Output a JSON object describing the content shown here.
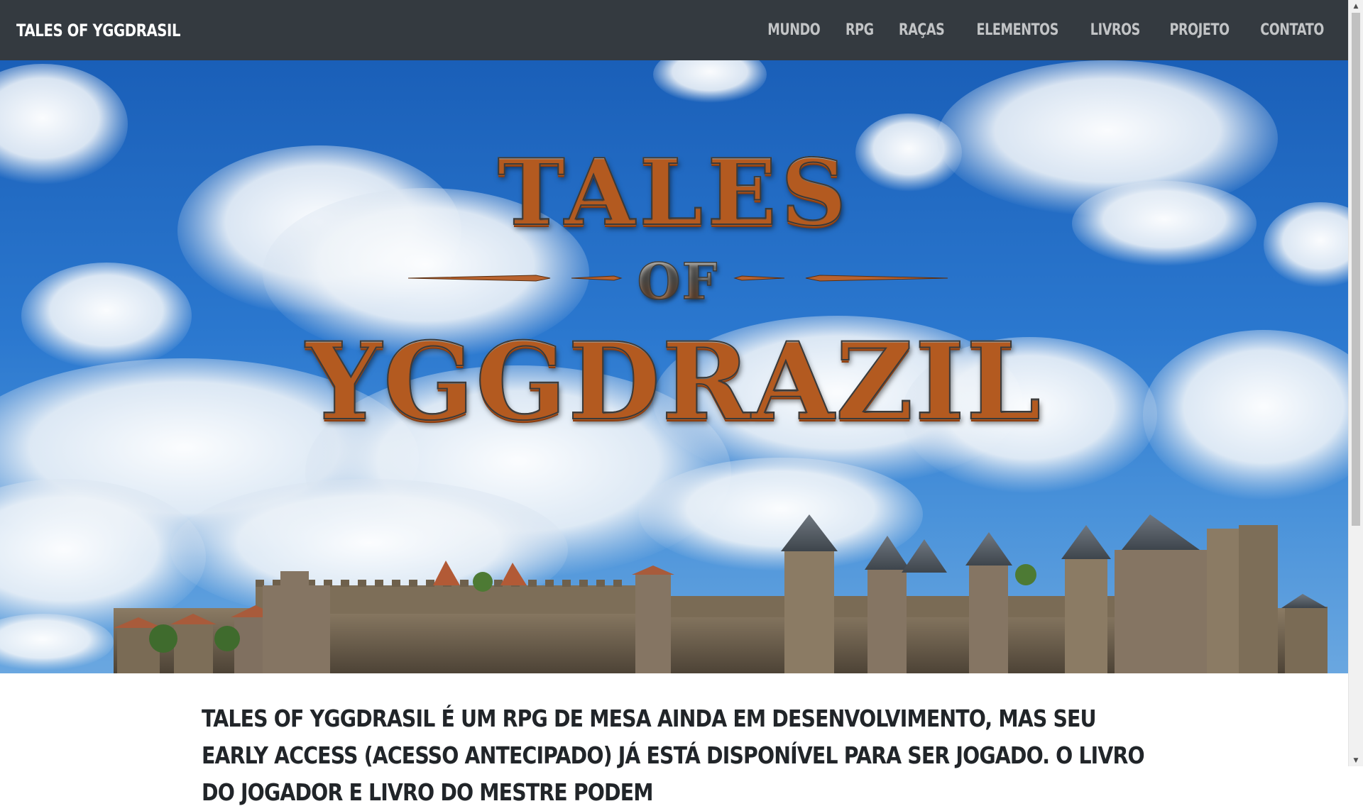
{
  "navbar": {
    "brand": "TALES OF YGGDRASIL",
    "links": [
      {
        "label": "MUNDO"
      },
      {
        "label": "RPG"
      },
      {
        "label": "RAÇAS"
      },
      {
        "label": "ELEMENTOS"
      },
      {
        "label": "LIVROS"
      },
      {
        "label": "PROJETO"
      },
      {
        "label": "CONTATO"
      }
    ]
  },
  "hero": {
    "logo": {
      "line1": "TALES",
      "line2": "OF",
      "line3": "YGGDRAZIL"
    }
  },
  "intro": {
    "text": "Tales of Yggdrasil é um RPG de mesa ainda em desenvolvimento, mas seu Early Access (Acesso Antecipado) já está disponível para ser jogado. O livro do jogador e livro do mestre podem"
  },
  "colors": {
    "navbar_bg": "#343a40",
    "nav_link": "#c2c4c6",
    "brand": "#ffffff",
    "sky": "#2b78cf"
  }
}
